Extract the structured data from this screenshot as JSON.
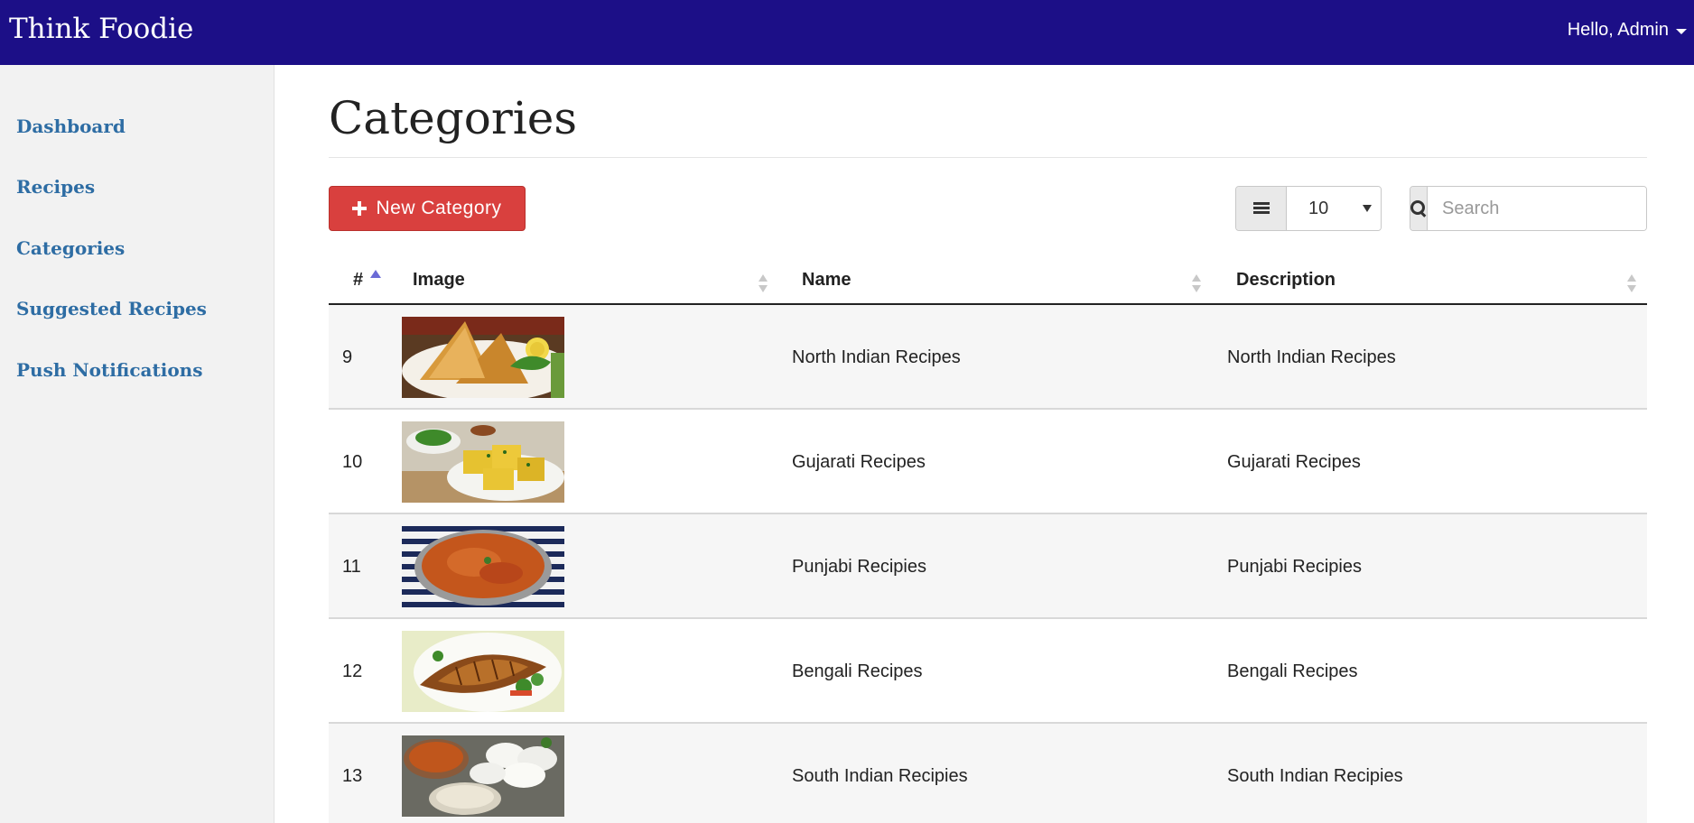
{
  "app": {
    "brand": "Think Foodie",
    "user_greeting": "Hello, Admin"
  },
  "sidebar": {
    "items": [
      {
        "label": "Dashboard"
      },
      {
        "label": "Recipes"
      },
      {
        "label": "Categories"
      },
      {
        "label": "Suggested Recipes"
      },
      {
        "label": "Push Notifications"
      }
    ]
  },
  "page": {
    "title": "Categories"
  },
  "toolbar": {
    "new_button_label": "New Category",
    "page_size": "10",
    "search_placeholder": "Search",
    "search_value": ""
  },
  "table": {
    "columns": [
      "#",
      "Image",
      "Name",
      "Description"
    ],
    "sort": {
      "column": "#",
      "direction": "asc"
    },
    "rows": [
      {
        "id": "9",
        "image": "samosa-photo",
        "name": "North Indian Recipes",
        "description": "North Indian Recipes"
      },
      {
        "id": "10",
        "image": "dhokla-photo",
        "name": "Gujarati Recipes",
        "description": "Gujarati Recipes"
      },
      {
        "id": "11",
        "image": "curry-photo",
        "name": "Punjabi Recipies",
        "description": "Punjabi Recipies"
      },
      {
        "id": "12",
        "image": "fried-fish-photo",
        "name": "Bengali Recipes",
        "description": "Bengali Recipes"
      },
      {
        "id": "13",
        "image": "idli-sambar-photo",
        "name": "South Indian Recipies",
        "description": "South Indian Recipies"
      }
    ]
  },
  "colors": {
    "topbar": "#1c0f87",
    "sidebar_bg": "#f2f2f2",
    "link": "#2e6da4",
    "primary_danger": "#d9403e",
    "row_stripe": "#f6f6f6"
  }
}
